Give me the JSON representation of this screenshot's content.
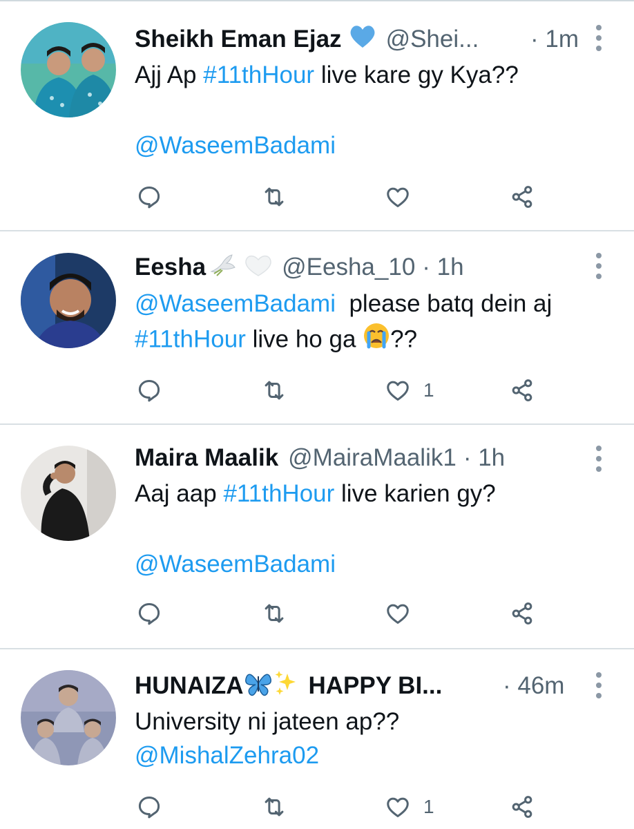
{
  "colors": {
    "link": "#1d9bf0",
    "muted": "#536471",
    "text": "#0f1419",
    "divider": "#d8dfe3"
  },
  "tweets": [
    {
      "name": "Sheikh Eman Ejaz",
      "name_badge": "blue-heart-icon",
      "handle": "@Shei...",
      "time": "· 1m",
      "lines": [
        {
          "pre": "Ajj Ap ",
          "tag": "#11thHour",
          "post": " live kare gy Kya??"
        },
        {
          "pre": "",
          "tag": "",
          "post": ""
        },
        {
          "pre": "",
          "tag": "@WaseemBadami",
          "post": ""
        }
      ],
      "likes": ""
    },
    {
      "name": "Eesha",
      "name_badge": "dove-white-heart-icon",
      "handle": "@Eesha_10",
      "time": "· 1h",
      "lines": [
        {
          "pre": "",
          "tag": "@WaseemBadami",
          "post": "  please batq dein aj"
        },
        {
          "pre": "",
          "tag": "#11thHour",
          "post": " live ho ga ",
          "emoji": "crying-face-icon",
          "after": "??"
        }
      ],
      "likes": "1"
    },
    {
      "name": "Maira Maalik",
      "handle": "@MairaMaalik1",
      "time": "· 1h",
      "lines": [
        {
          "pre": "Aaj aap ",
          "tag": "#11thHour",
          "post": " live karien gy?"
        },
        {
          "pre": "",
          "tag": "",
          "post": ""
        },
        {
          "pre": "",
          "tag": "@WaseemBadami",
          "post": ""
        }
      ],
      "likes": ""
    },
    {
      "name": "HUNAIZA",
      "name_badge": "butterfly-sparkles-icon",
      "name_suffix": "HAPPY BI...",
      "handle": "",
      "time": "· 46m",
      "lines": [
        {
          "pre": "University ni jateen ap??",
          "tag": "",
          "post": ""
        },
        {
          "pre": "",
          "tag": "@MishalZehra02",
          "post": ""
        }
      ],
      "likes": "1"
    }
  ]
}
